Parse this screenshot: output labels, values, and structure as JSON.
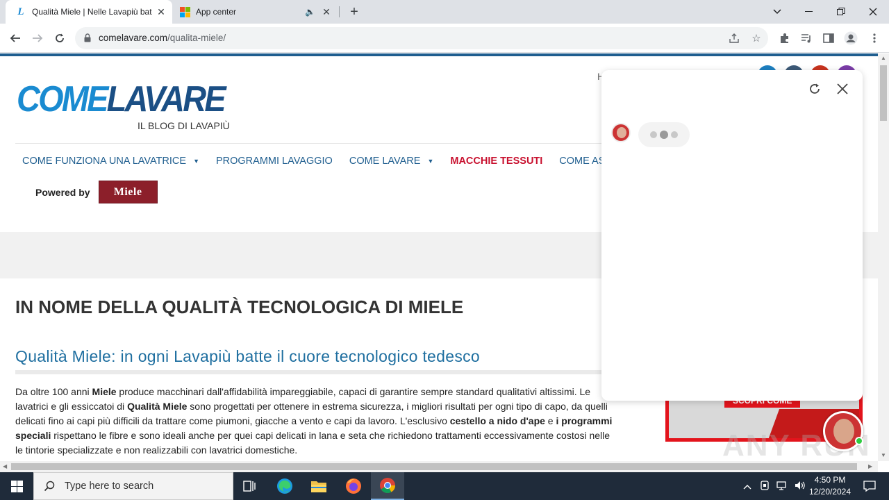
{
  "browser": {
    "tabs": [
      {
        "title": "Qualità Miele | Nelle Lavapiù bat",
        "active": true,
        "icon": "L"
      },
      {
        "title": "App center",
        "active": false,
        "icon": "microsoft-logo"
      }
    ],
    "url_host": "comelavare.com",
    "url_path": "/qualita-miele/"
  },
  "site": {
    "logo_come": "COME",
    "logo_lavare": "LAVARE",
    "logo_sub": "IL BLOG DI LAVAPIÙ",
    "menu": [
      {
        "label": "COME FUNZIONA UNA LAVATRICE",
        "has_caret": true
      },
      {
        "label": "PROGRAMMI LAVAGGIO",
        "has_caret": false
      },
      {
        "label": "COME LAVARE",
        "has_caret": true
      },
      {
        "label": "MACCHIE TESSUTI",
        "has_caret": false,
        "highlight": true
      },
      {
        "label": "COME ASC",
        "has_caret": false
      }
    ],
    "powered_by": "Powered by",
    "brand": "Miele",
    "header_letter": "H"
  },
  "article": {
    "h1": "IN NOME DELLA QUALITÀ TECNOLOGICA DI MIELE",
    "h2": "Qualità Miele: in ogni Lavapiù batte il cuore tecnologico tedesco",
    "p1_a": "Da oltre 100 anni ",
    "p1_b": "Miele",
    "p1_c": " produce macchinari dall'affidabilità impareggiabile, capaci di garantire sempre standard qualitativi altissimi. Le lavatrici e gli essiccatoi di ",
    "p1_d": "Qualità Miele",
    "p1_e": " sono progettati per ottenere in estrema sicurezza, i migliori risultati per ogni tipo di capo, da quelli delicati fino ai capi più difficili da trattare come piumoni, giacche a vento e capi da lavoro. L'esclusivo ",
    "p1_f": "cestello a nido d'ape",
    "p1_g": " e ",
    "p1_h": "i programmi speciali",
    "p1_i": " rispettano le fibre e sono ideali anche per quei capi delicati in lana e seta che richiedono trattamenti eccessivamente costosi nelle le tintorie specializzate e non realizzabili con lavatrici domestiche."
  },
  "banner": {
    "button": "SCOPRI COME"
  },
  "watermark": "ANY RUN",
  "taskbar": {
    "search_placeholder": "Type here to search",
    "time": "4:50 PM",
    "date": "12/20/2024"
  },
  "colors": {
    "accent": "#1f5e8f",
    "highlight": "#c8102e",
    "miele": "#8c1f2a"
  }
}
